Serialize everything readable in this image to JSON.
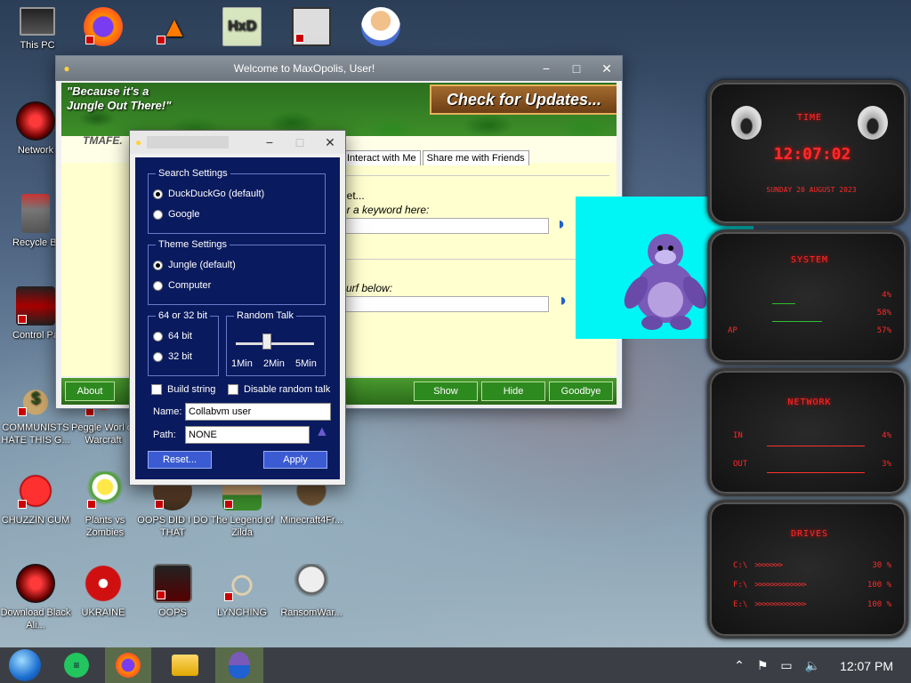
{
  "desktop_icons": [
    {
      "label": "This PC",
      "icon": "monitor-icon"
    },
    {
      "label": "",
      "icon": "firefox-icon"
    },
    {
      "label": "",
      "icon": "vlc-icon"
    },
    {
      "label": "",
      "icon": "hxd-icon"
    },
    {
      "label": "",
      "icon": "maze-icon"
    },
    {
      "label": "",
      "icon": "doctor-icon"
    },
    {
      "label": "Network",
      "icon": "alien-orb-icon"
    },
    {
      "label": "Recycle Bi",
      "icon": "recycle-bin-icon"
    },
    {
      "label": "Control Pa",
      "icon": "control-panel-icon"
    },
    {
      "label": "COMMUNISTS HATE THIS G...",
      "icon": "money-bag-icon"
    },
    {
      "label": "Peggle Worl of Warcraft",
      "icon": "peggle-icon"
    },
    {
      "label": "CHUZZIN CUM",
      "icon": "chuzzle-icon"
    },
    {
      "label": "Plants vs Zombies",
      "icon": "plant-icon"
    },
    {
      "label": "OOPS DID I DO THAT",
      "icon": "oops-icon"
    },
    {
      "label": "The Legend of Zilda",
      "icon": "zelda-icon"
    },
    {
      "label": "Minecraft4Fr...",
      "icon": "minecraft-icon"
    },
    {
      "label": "Download Black Ali...",
      "icon": "alien-orb-icon"
    },
    {
      "label": "UKRAINE",
      "icon": "radiation-icon"
    },
    {
      "label": "OOPS",
      "icon": "oops-screen-icon"
    },
    {
      "label": "LYNCHING",
      "icon": "noose-icon"
    },
    {
      "label": "RansomWar...",
      "icon": "skull-icon"
    }
  ],
  "main_window": {
    "title": "Welcome to MaxOpolis, User!",
    "slogan": "\"Because it's a Jungle Out There!\"",
    "update_banner": "Check for Updates...",
    "brand": "TMAFE.",
    "tabs": [
      "Interact with Me",
      "Share me with Friends"
    ],
    "search_heading": "net...",
    "search_prompt": "er a keyword here:",
    "surf_prompt": "surf below:",
    "buttons": {
      "about": "About",
      "show": "Show",
      "hide": "Hide",
      "goodbye": "Goodbye"
    }
  },
  "settings": {
    "search_group": "Search Settings",
    "search_options": [
      "DuckDuckGo (default)",
      "Google"
    ],
    "search_selected": 0,
    "theme_group": "Theme Settings",
    "theme_options": [
      "Jungle (default)",
      "Computer"
    ],
    "theme_selected": 0,
    "bits_group": "64 or 32 bit",
    "bits_options": [
      "64 bit",
      "32 bit"
    ],
    "random_group": "Random Talk",
    "random_ticks": [
      "1Min",
      "2Min",
      "5Min"
    ],
    "random_value": "2Min",
    "build_string": "Build string",
    "disable_random": "Disable random talk",
    "name_label": "Name:",
    "name_value": "Collabvm user",
    "path_label": "Path:",
    "path_value": "NONE",
    "reset": "Reset...",
    "apply": "Apply"
  },
  "gadgets": {
    "time_title": "TIME",
    "clock": "12:07:02",
    "date": "SUNDAY 20 AUGUST 2023",
    "system_title": "SYSTEM",
    "system_values": [
      "4%",
      "58%",
      "57%"
    ],
    "system_labels": [
      "",
      "",
      "AP"
    ],
    "network_title": "NETWORK",
    "network_rows": [
      {
        "label": "IN",
        "value": "4%"
      },
      {
        "label": "OUT",
        "value": "3%"
      }
    ],
    "drives_title": "DRIVES",
    "drive_rows": [
      {
        "label": "C:\\",
        "value": "30 %"
      },
      {
        "label": "F:\\",
        "value": "100 %"
      },
      {
        "label": "E:\\",
        "value": "100 %"
      }
    ]
  },
  "taskbar": {
    "items": [
      "start-orb-icon",
      "notes-icon",
      "firefox-icon",
      "file-explorer-icon",
      "bonzi-icon"
    ],
    "clock": "12:07 PM"
  }
}
